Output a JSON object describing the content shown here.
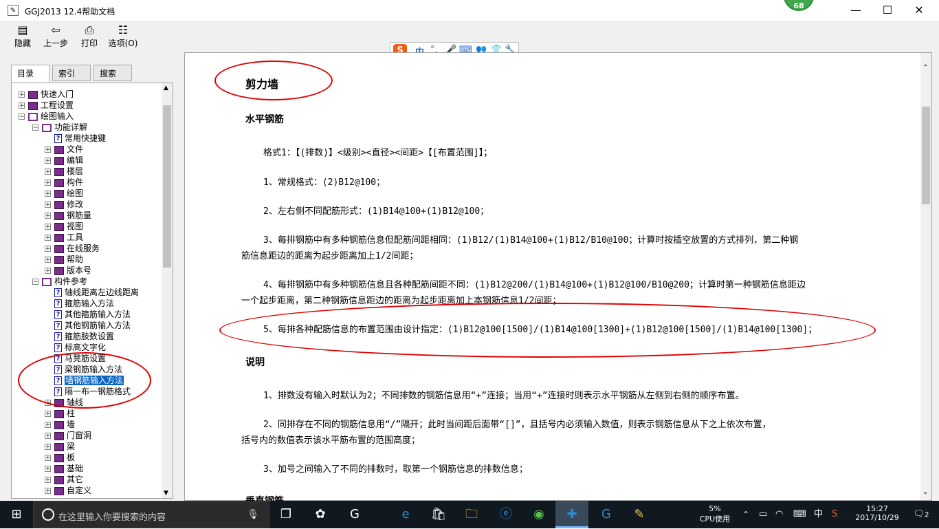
{
  "window": {
    "title": "GGJ2013 12.4帮助文档",
    "badge": "68",
    "controls": {
      "minimize": "—",
      "maximize": "☐",
      "close": "✕"
    }
  },
  "toolbar": {
    "buttons": [
      {
        "label": "隐藏",
        "icon": "hide-icon"
      },
      {
        "label": "上一步",
        "icon": "back-arrow-icon"
      },
      {
        "label": "打印",
        "icon": "print-icon"
      },
      {
        "label": "选项(O)",
        "icon": "options-icon"
      }
    ]
  },
  "ime_bar": {
    "logo": "S",
    "items": [
      "中",
      "°,",
      "🎤",
      "⌨",
      "👥",
      "👕",
      "🔧"
    ]
  },
  "left_tabs": [
    {
      "label": "目录(C)",
      "active": true
    },
    {
      "label": "索引(N)",
      "active": false
    },
    {
      "label": "搜索(S)",
      "active": false
    }
  ],
  "tree": [
    {
      "label": "快速入门",
      "type": "book",
      "level": 0,
      "exp": "+"
    },
    {
      "label": "工程设置",
      "type": "book",
      "level": 0,
      "exp": "+"
    },
    {
      "label": "绘图输入",
      "type": "open",
      "level": 0,
      "exp": "−"
    },
    {
      "label": "功能详解",
      "type": "open",
      "level": 1,
      "exp": "−"
    },
    {
      "label": "常用快捷键",
      "type": "page",
      "level": 2,
      "exp": ""
    },
    {
      "label": "文件",
      "type": "book",
      "level": 2,
      "exp": "+"
    },
    {
      "label": "编辑",
      "type": "book",
      "level": 2,
      "exp": "+"
    },
    {
      "label": "楼层",
      "type": "book",
      "level": 2,
      "exp": "+"
    },
    {
      "label": "构件",
      "type": "book",
      "level": 2,
      "exp": "+"
    },
    {
      "label": "绘图",
      "type": "book",
      "level": 2,
      "exp": "+"
    },
    {
      "label": "修改",
      "type": "book",
      "level": 2,
      "exp": "+"
    },
    {
      "label": "钢筋量",
      "type": "book",
      "level": 2,
      "exp": "+"
    },
    {
      "label": "视图",
      "type": "book",
      "level": 2,
      "exp": "+"
    },
    {
      "label": "工具",
      "type": "book",
      "level": 2,
      "exp": "+"
    },
    {
      "label": "在线服务",
      "type": "book",
      "level": 2,
      "exp": "+"
    },
    {
      "label": "帮助",
      "type": "book",
      "level": 2,
      "exp": "+"
    },
    {
      "label": "版本号",
      "type": "book",
      "level": 2,
      "exp": "+"
    },
    {
      "label": "构件参考",
      "type": "open",
      "level": 1,
      "exp": "−"
    },
    {
      "label": "轴线距离左边线距离",
      "type": "page",
      "level": 2,
      "exp": ""
    },
    {
      "label": "箍筋输入方法",
      "type": "page",
      "level": 2,
      "exp": ""
    },
    {
      "label": "其他箍筋输入方法",
      "type": "page",
      "level": 2,
      "exp": ""
    },
    {
      "label": "其他钢筋输入方法",
      "type": "page",
      "level": 2,
      "exp": ""
    },
    {
      "label": "箍筋肢数设置",
      "type": "page",
      "level": 2,
      "exp": ""
    },
    {
      "label": "标高文字化",
      "type": "page",
      "level": 2,
      "exp": ""
    },
    {
      "label": "马凳筋设置",
      "type": "page",
      "level": 2,
      "exp": ""
    },
    {
      "label": "梁钢筋输入方法",
      "type": "page",
      "level": 2,
      "exp": ""
    },
    {
      "label": "墙钢筋输入方法",
      "type": "page",
      "level": 2,
      "exp": "",
      "selected": true
    },
    {
      "label": "隔一布一钢筋格式",
      "type": "page",
      "level": 2,
      "exp": ""
    },
    {
      "label": "轴线",
      "type": "book",
      "level": 2,
      "exp": "+"
    },
    {
      "label": "柱",
      "type": "book",
      "level": 2,
      "exp": "+"
    },
    {
      "label": "墙",
      "type": "book",
      "level": 2,
      "exp": "+"
    },
    {
      "label": "门窗洞",
      "type": "book",
      "level": 2,
      "exp": "+"
    },
    {
      "label": "梁",
      "type": "book",
      "level": 2,
      "exp": "+"
    },
    {
      "label": "板",
      "type": "book",
      "level": 2,
      "exp": "+"
    },
    {
      "label": "基础",
      "type": "book",
      "level": 2,
      "exp": "+"
    },
    {
      "label": "其它",
      "type": "book",
      "level": 2,
      "exp": "+"
    },
    {
      "label": "自定义",
      "type": "book",
      "level": 2,
      "exp": "+"
    }
  ],
  "doc": {
    "title": "剪力墙",
    "section1": "水平钢筋",
    "format": "格式1：【(排数)】<级别><直径><间距>【[布置范围]】；",
    "p1": "1、常规格式：(2)B12@100；",
    "p2": "2、左右侧不同配筋形式：(1)B14@100+(1)B12@100；",
    "p3a": "3、每排钢筋中有多种钢筋信息但配筋间距相同：(1)B12/(1)B14@100+(1)B12/B10@100；计算时按插空放置的方式排列，第二种钢",
    "p3b": "筋信息距边的距离为起步距离加上1/2间距；",
    "p4a": "4、每排钢筋中有多种钢筋信息且各种配筋间距不同：(1)B12@200/(1)B14@100+(1)B12@100/B10@200；计算时第一种钢筋信息距边",
    "p4b": "一个起步距离，第二种钢筋信息距边的距离为起步距离加上本钢筋信息1/2间距；",
    "p5": "5、每排各种配筋信息的布置范围由设计指定：(1)B12@100[1500]/(1)B14@100[1300]+(1)B12@100[1500]/(1)B14@100[1300]；",
    "section2": "说明",
    "n1": "1、排数没有输入时默认为2；不同排数的钢筋信息用“+”连接；当用“+”连接时则表示水平钢筋从左侧到右侧的顺序布置。",
    "n2a": "2、同排存在不同的钢筋信息用“/”隔开；此时当间距后面带“[]”，且括号内必须输入数值，则表示钢筋信息从下之上依次布置，",
    "n2b": "括号内的数值表示该水平筋布置的范围高度；",
    "n3": "3、加号之间输入了不同的排数时，取第一个钢筋信息的排数信息；",
    "section3": "垂直钢筋"
  },
  "taskbar": {
    "search_placeholder": "在这里输入你要搜索的内容",
    "apps": [
      "task-view-icon",
      "pinwheel-icon",
      "browser-g-icon",
      "edge-icon",
      "store-icon",
      "file-explorer-icon",
      "ie-icon",
      "green-app-icon",
      "help-app-icon",
      "glodon-icon",
      "notes-icon"
    ],
    "cpu_percent": "5%",
    "cpu_label": "CPU使用",
    "ime": "中",
    "time": "15:27",
    "date": "2017/10/29",
    "notifications": "2"
  },
  "colors": {
    "annotation": "#e00000",
    "selection": "#0a64c8",
    "book": "#7a2e8c",
    "taskbar": "#101820"
  }
}
